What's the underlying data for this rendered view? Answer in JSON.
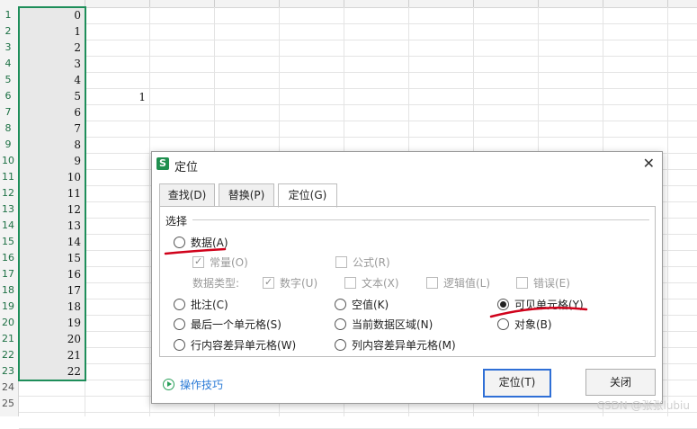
{
  "sheet": {
    "row_numbers": [
      "1",
      "2",
      "3",
      "4",
      "5",
      "6",
      "7",
      "8",
      "9",
      "10",
      "11",
      "12",
      "13",
      "14",
      "15",
      "16",
      "17",
      "18",
      "19",
      "20",
      "21",
      "22",
      "23",
      "24",
      "25"
    ],
    "col_a_values": [
      "0",
      "1",
      "2",
      "3",
      "4",
      "5",
      "6",
      "7",
      "8",
      "9",
      "10",
      "11",
      "12",
      "13",
      "14",
      "15",
      "16",
      "17",
      "18",
      "19",
      "20",
      "21",
      "22"
    ],
    "cell_c6": "1"
  },
  "dialog": {
    "title": "定位",
    "app_badge": "S",
    "close": "✕",
    "tabs": [
      "查找(D)",
      "替换(P)",
      "定位(G)"
    ],
    "section": "选择",
    "options": {
      "data": "数据(A)",
      "constants": "常量(O)",
      "formulas": "公式(R)",
      "data_type_label": "数据类型:",
      "numbers": "数字(U)",
      "text": "文本(X)",
      "logicals": "逻辑值(L)",
      "errors": "错误(E)",
      "comments": "批注(C)",
      "blanks": "空值(K)",
      "visible_cells": "可见单元格(Y)",
      "last_cell": "最后一个单元格(S)",
      "current_region": "当前数据区域(N)",
      "objects": "对象(B)",
      "row_diff": "行内容差异单元格(W)",
      "col_diff": "列内容差异单元格(M)"
    },
    "tips": "操作技巧",
    "buttons": {
      "ok": "定位(T)",
      "close": "关闭"
    }
  },
  "watermark": "CSDN @张张lubiu",
  "colors": {
    "accent_green": "#1e8e5a",
    "selection_border": "#1e8e5a",
    "annotation_red": "#d0021b",
    "link_blue": "#2a7ad6"
  }
}
